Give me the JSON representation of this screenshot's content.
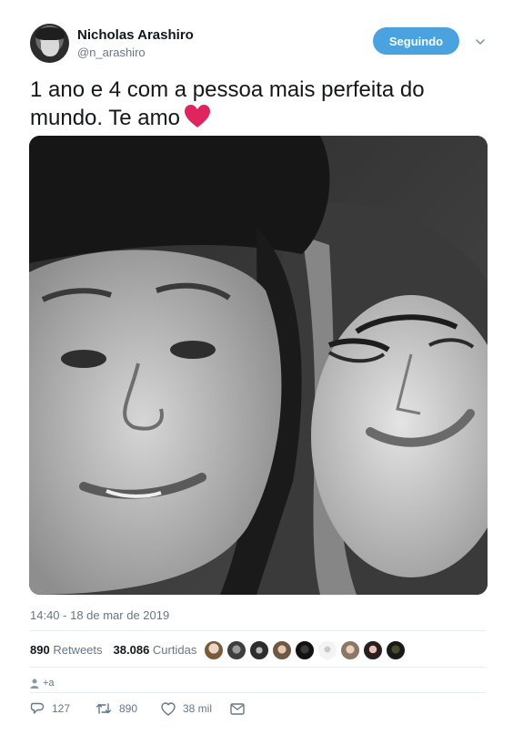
{
  "author": {
    "display_name": "Nicholas Arashiro",
    "handle": "@n_arashiro",
    "follow_label": "Seguindo"
  },
  "tweet": {
    "text": "1 ano e 4 com a pessoa mais perfeita do mundo. Te amo",
    "emoji": "heart-icon",
    "timestamp": "14:40 - 18 de mar de 2019"
  },
  "stats": {
    "retweets_count": "890",
    "retweets_label": "Retweets",
    "likes_count": "38.086",
    "likes_label": "Curtidas",
    "liker_avatars": 9
  },
  "reply": {
    "label": "+a"
  },
  "actions": {
    "reply_count": "127",
    "retweet_count": "890",
    "like_count": "38 mil"
  },
  "colors": {
    "accent": "#4aa3df",
    "text": "#14171a",
    "secondary": "#657786",
    "heart": "#e0245e"
  }
}
